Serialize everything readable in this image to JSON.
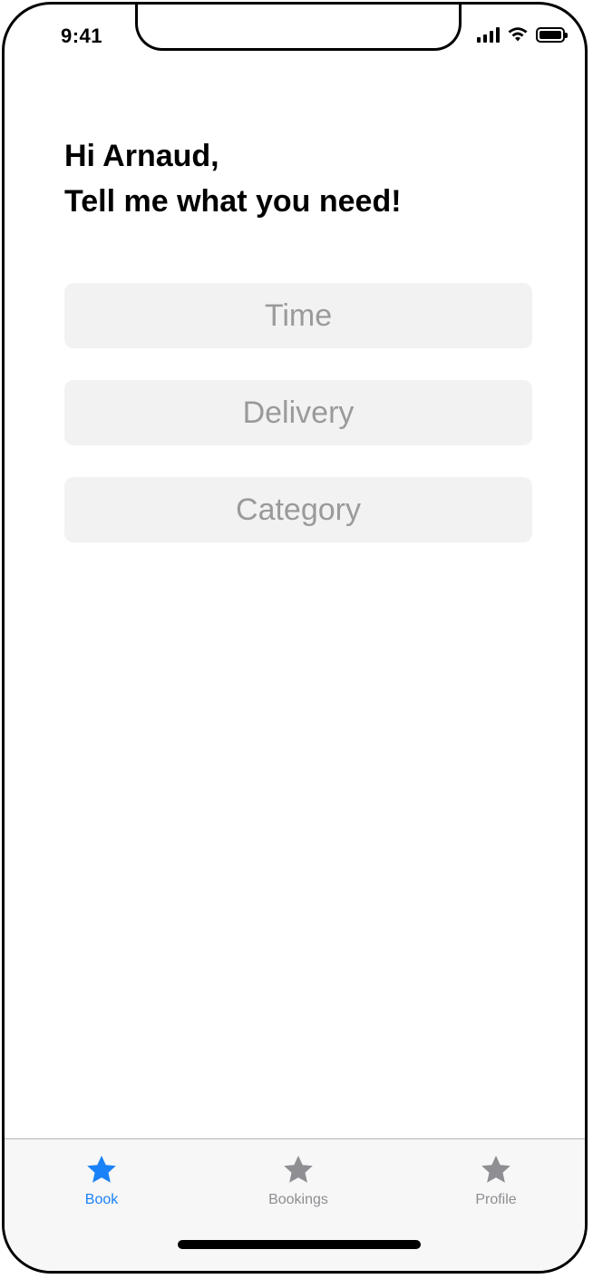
{
  "status_bar": {
    "time": "9:41",
    "icons": [
      "cellular-signal-icon",
      "wifi-icon",
      "battery-icon"
    ]
  },
  "greeting": {
    "line1": "Hi Arnaud,",
    "line2": "Tell me what you need!"
  },
  "options": [
    {
      "label": "Time"
    },
    {
      "label": "Delivery"
    },
    {
      "label": "Category"
    }
  ],
  "tab_bar": {
    "tabs": [
      {
        "label": "Book",
        "icon": "star-icon",
        "active": true
      },
      {
        "label": "Bookings",
        "icon": "star-icon",
        "active": false
      },
      {
        "label": "Profile",
        "icon": "star-icon",
        "active": false
      }
    ]
  },
  "colors": {
    "accent": "#1a82f7",
    "inactive": "#8e8e93",
    "option_bg": "#f2f2f2",
    "option_text": "#9a9a9a"
  }
}
